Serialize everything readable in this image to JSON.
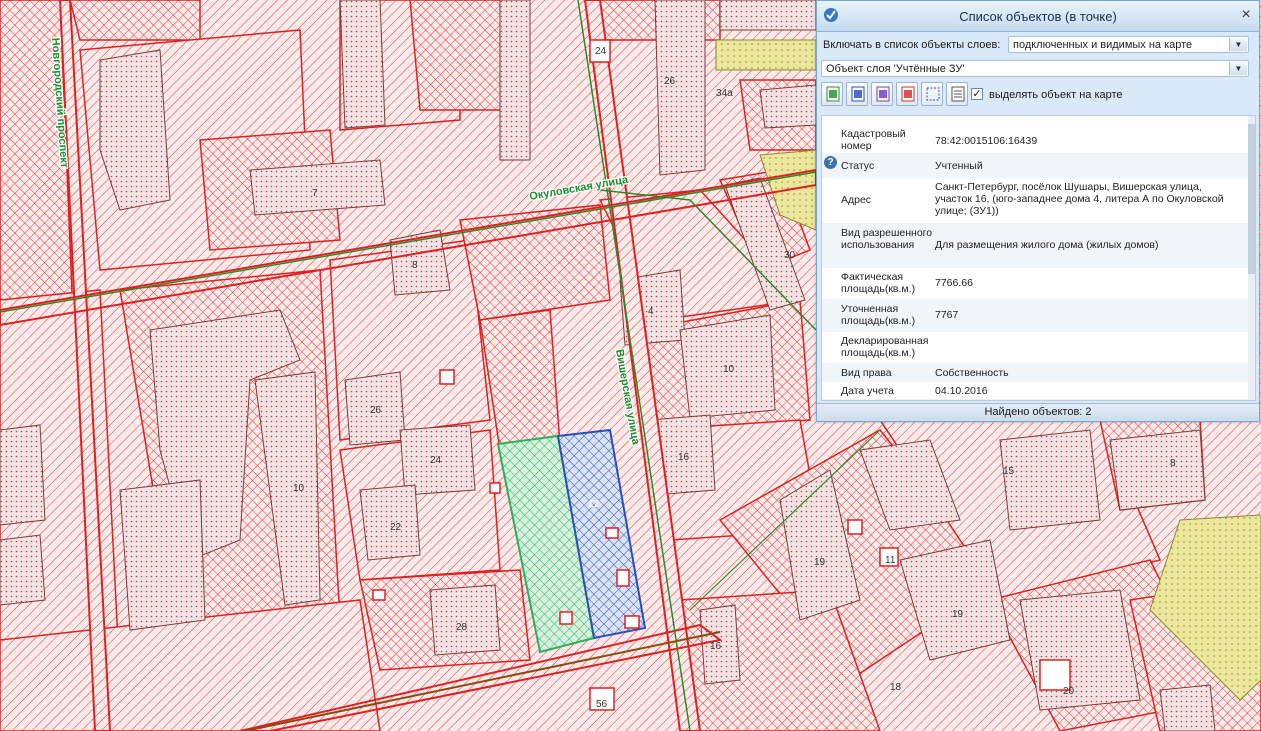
{
  "map": {
    "street_labels": {
      "novgorodsky": "Новгородский проспект",
      "okulovskaya": "Окуловская улица",
      "visherskaya": "Вишерская улица"
    },
    "house_numbers": [
      "24",
      "26",
      "34а",
      "7",
      "8",
      "30",
      "4",
      "10",
      "26",
      "24",
      "22",
      "10",
      "28",
      "16",
      "15",
      "8",
      "19",
      "11",
      "19",
      "18",
      "16",
      "56",
      "17",
      "20"
    ],
    "colors": {
      "parcel_red": "#e02020",
      "selected_green": "#3cb96a",
      "selected_blue": "#2a4fb8",
      "olive_fill": "#e8e49a",
      "street_green": "#1a8f2a"
    }
  },
  "panel": {
    "title": "Список объектов (в точке)",
    "close_glyph": "×",
    "include_label": "Включать в список объекты слоев:",
    "include_value": "подключенных и видимых на карте",
    "layer_value": "Объект слоя 'Учтённые ЗУ'",
    "highlight_label": "выделять объект на карте",
    "highlight_checked": true,
    "toolbar_icons": [
      "excel-doc-icon",
      "word-doc-icon",
      "pdf-doc-icon",
      "export-doc-icon",
      "select-area-icon",
      "table-doc-icon"
    ],
    "properties": [
      {
        "name": "Кадастровый номер",
        "value": "78:42:0015106:16439"
      },
      {
        "name": "Статус",
        "value": "Учтенный"
      },
      {
        "name": "Адрес",
        "value": "Санкт-Петербург, посёлок Шушары, Вишерская улица, участок 16, (юго-западнее дома 4, литера А по Окуловской улице; (ЗУ1))"
      },
      {
        "name": "Вид разрешенного использования",
        "value": "Для размещения жилого дома (жилых домов)"
      },
      {
        "name": "Фактическая площадь(кв.м.)",
        "value": "7766.66"
      },
      {
        "name": "Уточненная площадь(кв.м.)",
        "value": "7767"
      },
      {
        "name": "Декларированная площадь(кв.м.)",
        "value": ""
      },
      {
        "name": "Вид права",
        "value": "Собственность"
      },
      {
        "name": "Дата учета",
        "value": "04.10.2016"
      }
    ],
    "status": "Найдено объектов: 2"
  }
}
